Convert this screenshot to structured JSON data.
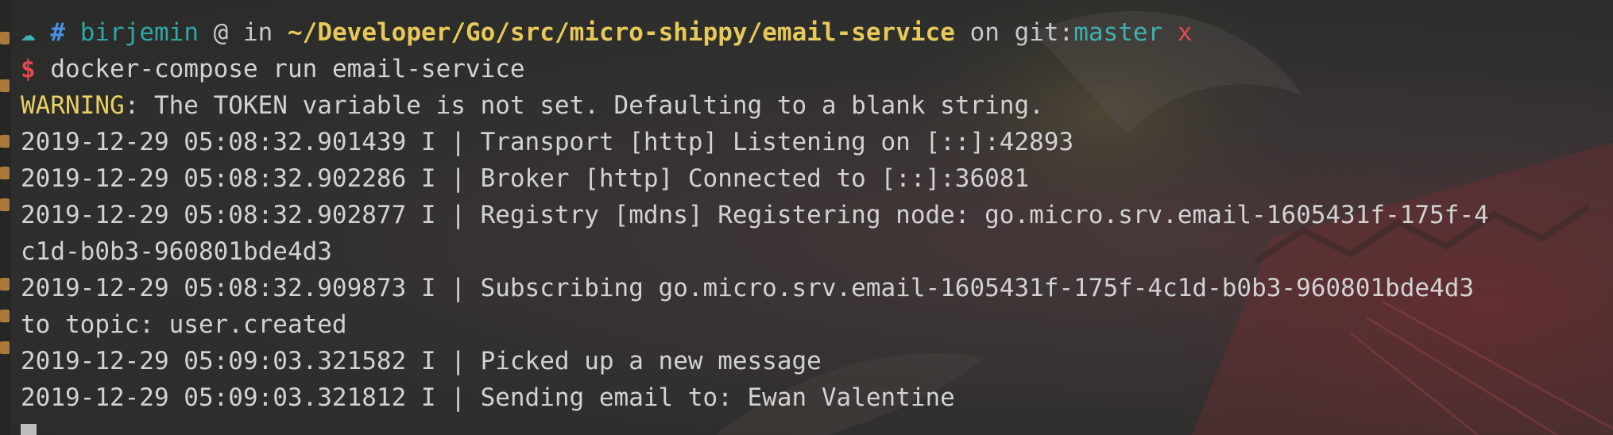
{
  "window": {
    "kind": "terminal"
  },
  "prompt": {
    "cloud_glyph": "☁",
    "hash": "#",
    "user": "birjemin",
    "at": "@",
    "in": "in",
    "path": "~/Developer/Go/src/micro-shippy/email-service",
    "on": "on",
    "git_label": "git:",
    "branch": "master",
    "dirty": "x",
    "dollar": "$",
    "command": "docker-compose run email-service"
  },
  "output": {
    "warning_label": "WARNING",
    "warning_text": ": The TOKEN variable is not set. Defaulting to a blank string.",
    "lines": [
      "2019-12-29 05:08:32.901439 I | Transport [http] Listening on [::]:42893",
      "2019-12-29 05:08:32.902286 I | Broker [http] Connected to [::]:36081",
      "2019-12-29 05:08:32.902877 I | Registry [mdns] Registering node: go.micro.srv.email-1605431f-175f-4",
      "c1d-b0b3-960801bde4d3",
      "2019-12-29 05:08:32.909873 I | Subscribing go.micro.srv.email-1605431f-175f-4c1d-b0b3-960801bde4d3",
      "to topic: user.created",
      "2019-12-29 05:09:03.321582 I | Picked up a new message",
      "2019-12-29 05:09:03.321812 I | Sending email to: Ewan Valentine"
    ]
  },
  "colors": {
    "background": "#2e2e2c",
    "text": "#d2d2d2",
    "path": "#e7c95a",
    "branch": "#3fb0b0",
    "error_red": "#e0484f",
    "warning": "#e9cf64"
  }
}
